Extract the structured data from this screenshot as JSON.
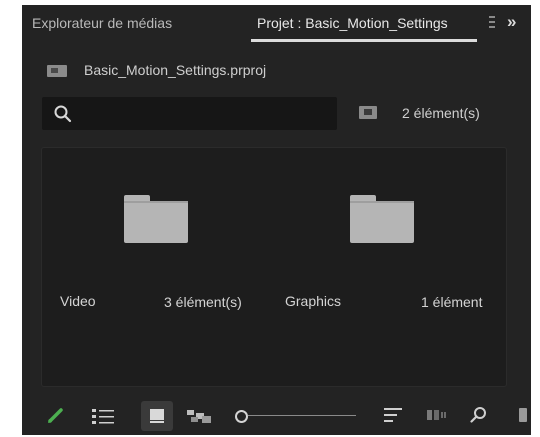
{
  "tabs": [
    {
      "label": "Explorateur de médias",
      "active": false
    },
    {
      "label": "Projet : Basic_Motion_Settings",
      "active": true
    }
  ],
  "overflow_symbol": "»",
  "project": {
    "file_name": "Basic_Motion_Settings.prproj",
    "icon": "project-file-icon"
  },
  "search": {
    "value": "",
    "placeholder": ""
  },
  "item_count": "2 élément(s)",
  "bins": [
    {
      "name": "Video",
      "count": "3 élément(s)"
    },
    {
      "name": "Graphics",
      "count": "1 élément"
    }
  ],
  "toolbar": {
    "icons": [
      "pencil-icon",
      "list-view-icon",
      "icon-view-icon",
      "freeform-view-icon",
      "zoom-slider",
      "sort-icon",
      "automate-icon",
      "find-icon",
      "new-item-icon"
    ],
    "active_view": "icon-view",
    "zoom_level_fraction": 0.0
  },
  "colors": {
    "panel_bg": "#232323",
    "grid_bg": "#1d1d1d",
    "folder": "#b5b5b5",
    "accent_pen": "#4caf50"
  }
}
